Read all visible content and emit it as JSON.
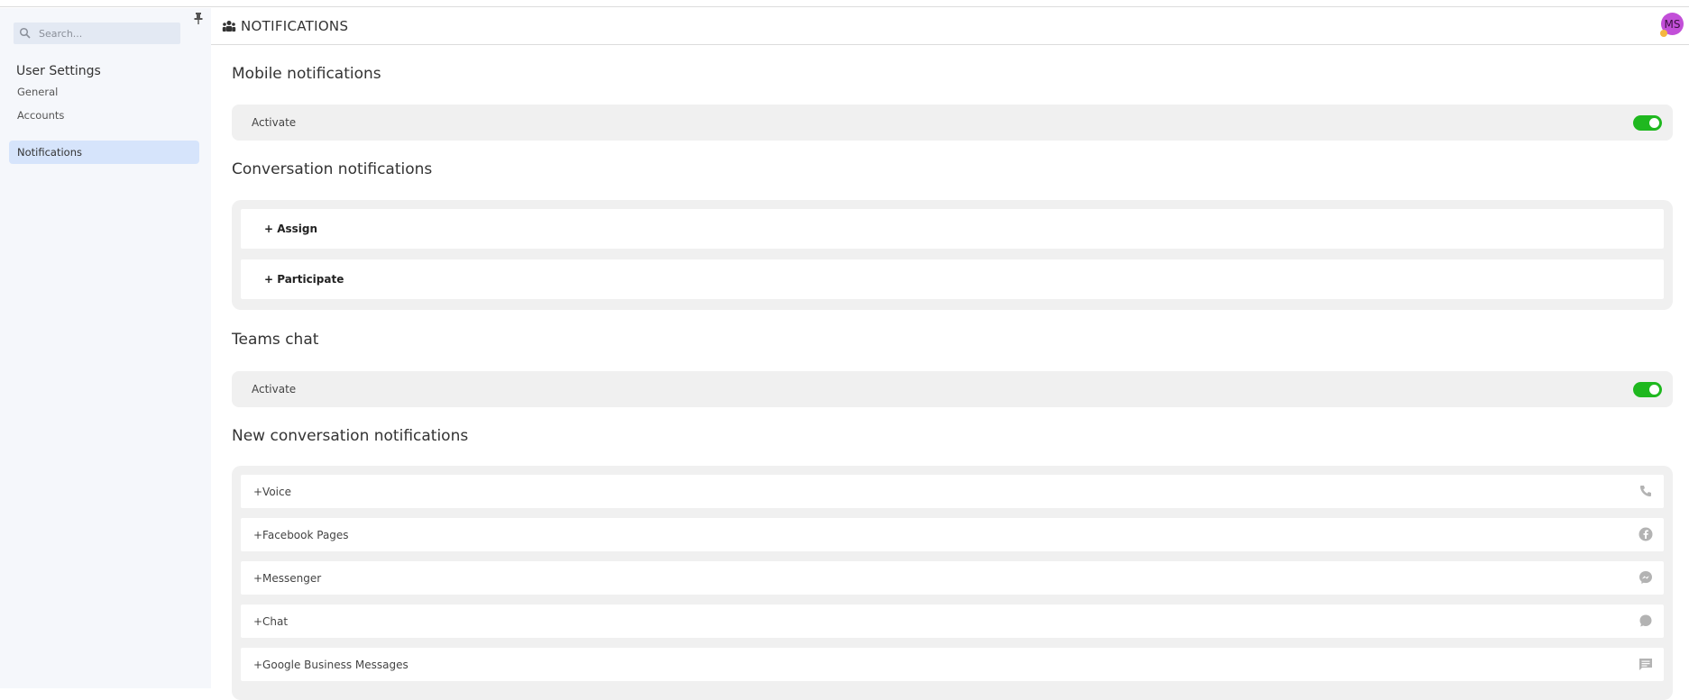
{
  "sidebar": {
    "search_placeholder": "Search...",
    "title": "User Settings",
    "items": [
      {
        "label": "General"
      },
      {
        "label": "Accounts"
      },
      {
        "label": "Notifications"
      }
    ]
  },
  "header": {
    "title": "NOTIFICATIONS",
    "avatar_initials": "MS"
  },
  "sections": {
    "mobile": {
      "title": "Mobile notifications",
      "row_label": "Activate",
      "toggle_on": true
    },
    "conversation": {
      "title": "Conversation notifications",
      "items": [
        "+ Assign",
        "+ Participate"
      ]
    },
    "teams": {
      "title": "Teams chat",
      "row_label": "Activate",
      "toggle_on": true
    },
    "new_conversation": {
      "title": "New conversation notifications",
      "items": [
        {
          "label": "+Voice",
          "icon": "phone-icon"
        },
        {
          "label": "+Facebook Pages",
          "icon": "facebook-icon"
        },
        {
          "label": "+Messenger",
          "icon": "messenger-icon"
        },
        {
          "label": "+Chat",
          "icon": "chat-bubble-icon"
        },
        {
          "label": "+Google Business Messages",
          "icon": "message-icon"
        }
      ]
    }
  },
  "colors": {
    "toggle_on": "#1fb81f",
    "sidebar_bg": "#f5f7fb",
    "active_item_bg": "#d6e4fb",
    "avatar_bg": "#c24fd8"
  }
}
